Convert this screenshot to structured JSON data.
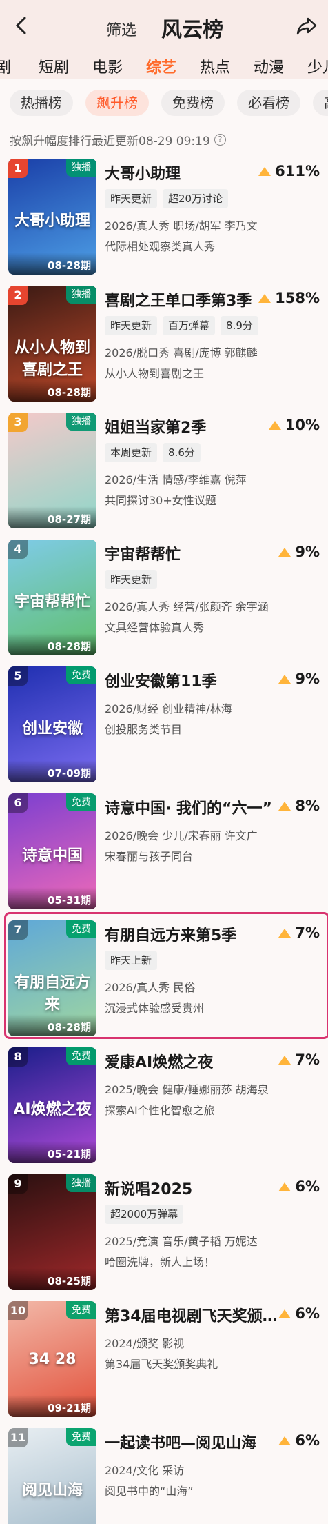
{
  "header": {
    "title": "风云榜",
    "filter": "筛选"
  },
  "categories": [
    "剧",
    "短剧",
    "电影",
    "综艺",
    "热点",
    "动漫",
    "少儿"
  ],
  "tabs": [
    "热播榜",
    "飙升榜",
    "免费榜",
    "必看榜",
    "高"
  ],
  "subline": "按飙升幅度排行最近更新08-29 09:19",
  "items": [
    {
      "rank": "1",
      "badge": "独播",
      "period": "08-28期",
      "title": "大哥小助理",
      "delta": "611%",
      "tags": [
        "昨天更新",
        "超20万讨论"
      ],
      "meta1": "2026/真人秀 职场/胡军 李乃文",
      "meta2": "代际相处观察类真人秀",
      "poster_text": "大哥小助理",
      "c1": "#1a3fa8",
      "c2": "#4ea0e6"
    },
    {
      "rank": "2",
      "badge": "独播",
      "period": "08-28期",
      "title": "喜剧之王单口季第3季",
      "delta": "158%",
      "tags": [
        "昨天更新",
        "百万弹幕",
        "8.9分"
      ],
      "meta1": "2026/脱口秀 喜剧/庞博 郭麒麟",
      "meta2": "从小人物到喜剧之王",
      "poster_text": "从小人物到喜剧之王",
      "c1": "#3a1a14",
      "c2": "#c24a2a"
    },
    {
      "rank": "3",
      "badge": "独播",
      "period": "08-27期",
      "title": "姐姐当家第2季",
      "delta": "10%",
      "tags": [
        "本周更新",
        "8.6分"
      ],
      "meta1": "2026/生活 情感/李维嘉 倪萍",
      "meta2": "共同探讨30+女性议题",
      "poster_text": "",
      "c1": "#f4c9c9",
      "c2": "#8fd6c9"
    },
    {
      "rank": "4",
      "badge": "",
      "period": "08-28期",
      "title": "宇宙帮帮忙",
      "delta": "9%",
      "tags": [
        "昨天更新"
      ],
      "meta1": "2026/真人秀 经营/张颜齐 余宇涵",
      "meta2": "文具经营体验真人秀",
      "poster_text": "宇宙帮帮忙",
      "c1": "#7fcbe8",
      "c2": "#5fbf6a"
    },
    {
      "rank": "5",
      "badge": "免费",
      "period": "07-09期",
      "title": "创业安徽第11季",
      "delta": "9%",
      "tags": [],
      "meta1": "2026/财经 创业精神/林海",
      "meta2": "创投服务类节目",
      "poster_text": "创业安徽",
      "c1": "#1f2fb0",
      "c2": "#7b6cf0"
    },
    {
      "rank": "6",
      "badge": "免费",
      "period": "05-31期",
      "title": "诗意中国· 我们的“六一”",
      "delta": "8%",
      "tags": [],
      "meta1": "2026/晚会 少儿/宋春丽 许文广",
      "meta2": "宋春丽与孩子同台",
      "poster_text": "诗意中国",
      "c1": "#7b3fd0",
      "c2": "#f06ab8"
    },
    {
      "rank": "7",
      "badge": "免费",
      "period": "08-28期",
      "title": "有朋自远方来第5季",
      "delta": "7%",
      "tags": [
        "昨天上新"
      ],
      "meta1": "2026/真人秀 民俗",
      "meta2": "沉浸式体验感受贵州",
      "poster_text": "有朋自远方来",
      "c1": "#5fa8d8",
      "c2": "#9fd6a0"
    },
    {
      "rank": "8",
      "badge": "免费",
      "period": "05-21期",
      "title": "爱康AI焕燃之夜",
      "delta": "7%",
      "tags": [],
      "meta1": "2025/晚会 健康/锤娜丽莎 胡海泉",
      "meta2": "探索AI个性化智愈之旅",
      "poster_text": "AI焕燃之夜",
      "c1": "#1a1e8a",
      "c2": "#b04ad8"
    },
    {
      "rank": "9",
      "badge": "独播",
      "period": "08-25期",
      "title": "新说唱2025",
      "delta": "6%",
      "tags": [
        "超2000万弹幕"
      ],
      "meta1": "2025/竞演 音乐/黄子韬 万妮达",
      "meta2": "哈圈洗牌，新人上场！",
      "poster_text": "",
      "c1": "#2a1010",
      "c2": "#a0282a"
    },
    {
      "rank": "10",
      "badge": "免费",
      "period": "09-21期",
      "title": "第34届电视剧飞天奖颁…",
      "delta": "6%",
      "tags": [],
      "meta1": "2024/颁奖 影视",
      "meta2": "第34届飞天奖颁奖典礼",
      "poster_text": "34 28",
      "c1": "#f2b8a8",
      "c2": "#e2503a"
    },
    {
      "rank": "11",
      "badge": "免费",
      "period": "",
      "title": "一起读书吧—阅见山海",
      "delta": "6%",
      "tags": [],
      "meta1": "2024/文化 采访",
      "meta2": "阅见书中的“山海”",
      "poster_text": "阅见山海",
      "c1": "#e8eef2",
      "c2": "#9fb8c8"
    }
  ],
  "colors": {
    "accent": "#ff6a2a",
    "rank_bg": "#e6452f",
    "rank_alt": "#f2a531",
    "up": "#ffb43a",
    "highlight": "#d8336f"
  }
}
